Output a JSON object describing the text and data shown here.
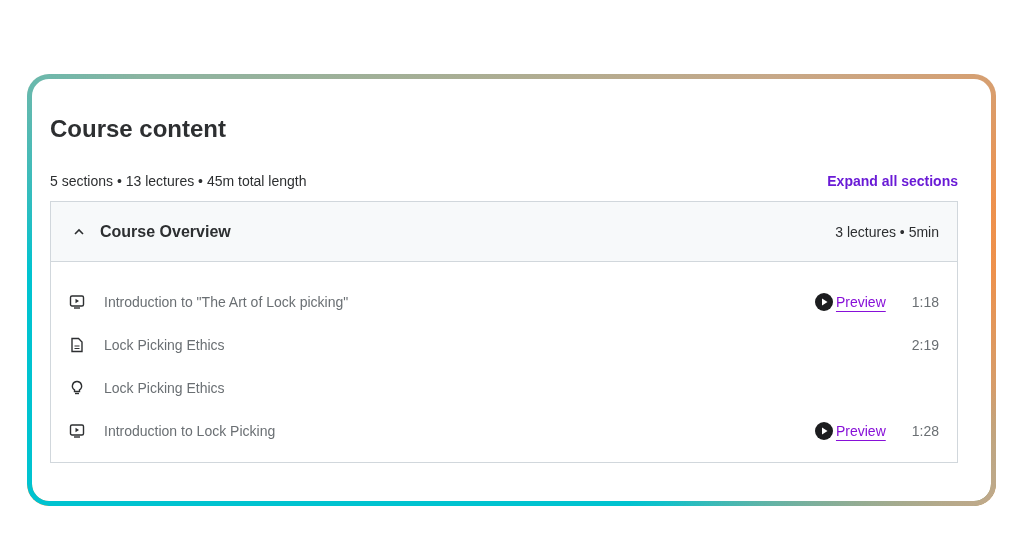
{
  "title": "Course content",
  "summary": "5 sections • 13 lectures • 45m total length",
  "expand_link": "Expand all sections",
  "section": {
    "title": "Course Overview",
    "expanded": true,
    "meta": "3 lectures • 5min",
    "lectures": [
      {
        "kind": "video",
        "title": "Introduction to \"The Art of Lock picking\"",
        "preview": "Preview",
        "duration": "1:18"
      },
      {
        "kind": "article",
        "title": "Lock Picking Ethics",
        "duration": "2:19"
      },
      {
        "kind": "quiz",
        "title": "Lock Picking Ethics"
      },
      {
        "kind": "video",
        "title": "Introduction to Lock Picking",
        "preview": "Preview",
        "duration": "1:28"
      }
    ]
  }
}
